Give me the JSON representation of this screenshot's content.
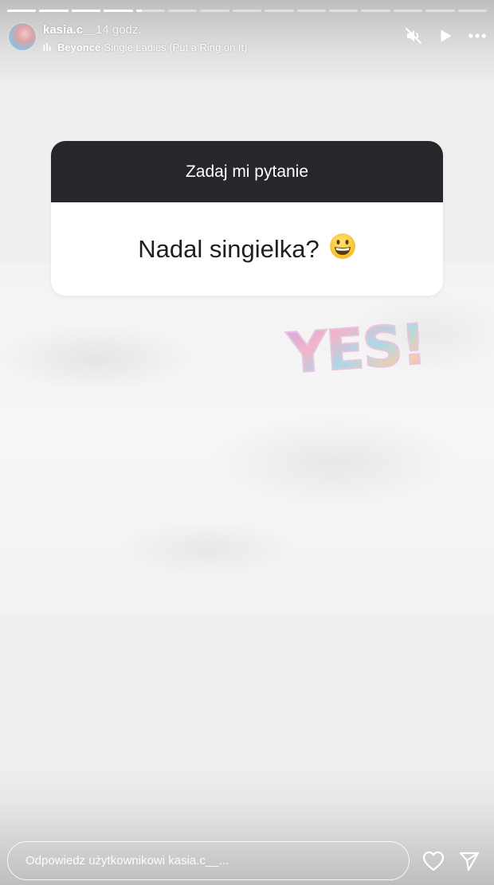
{
  "story": {
    "progress": [
      1,
      1,
      1,
      1,
      0.2,
      0,
      0,
      0,
      0,
      0,
      0,
      0,
      0,
      0,
      0
    ]
  },
  "header": {
    "username": "kasia.c__",
    "time": "14 godz.",
    "music": {
      "artist": "Beyoncé",
      "separator": " · ",
      "song": "Single Ladies (Put a Ring on It)"
    },
    "icons": [
      "music-bars-icon",
      "muted-speaker-icon",
      "play-icon",
      "more-options-icon"
    ]
  },
  "question_sticker": {
    "header": "Zadaj mi pytanie",
    "question": "Nadal singielka?",
    "emoji": "😀"
  },
  "text_sticker": {
    "text": "YES!"
  },
  "footer": {
    "reply_placeholder": "Odpowiedz użytkownikowi kasia.c__...",
    "icons": [
      "heart-icon",
      "send-icon"
    ]
  },
  "colors": {
    "card_header": "#25272b",
    "card_body": "#ffffff",
    "background": "#efefef"
  }
}
